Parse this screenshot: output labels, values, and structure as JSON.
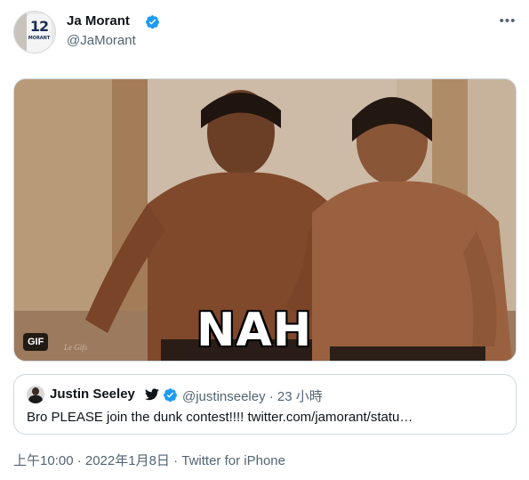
{
  "tweet": {
    "author": {
      "name": "Ja Morant",
      "handle": "@JaMorant",
      "avatar_number": "12",
      "avatar_name": "MORANT",
      "verified_icon": "verified-badge-icon"
    },
    "more_label": "•••",
    "media": {
      "type": "gif",
      "caption": "NAH",
      "badge": "GIF",
      "watermark": "Le Gifs"
    },
    "quote": {
      "author_name": "Justin Seeley",
      "author_emoji": "twitter-bird-icon",
      "handle_time": "@justinseeley · 23 小時",
      "text": "Bro PLEASE join the dunk contest!!!! twitter.com/jamorant/statu…"
    },
    "meta": "上午10:00 · 2022年1月8日 · Twitter for iPhone"
  },
  "colors": {
    "verified": "#1d9bf0",
    "text_primary": "#0f1419",
    "text_secondary": "#536471",
    "border": "#cfd9de"
  }
}
